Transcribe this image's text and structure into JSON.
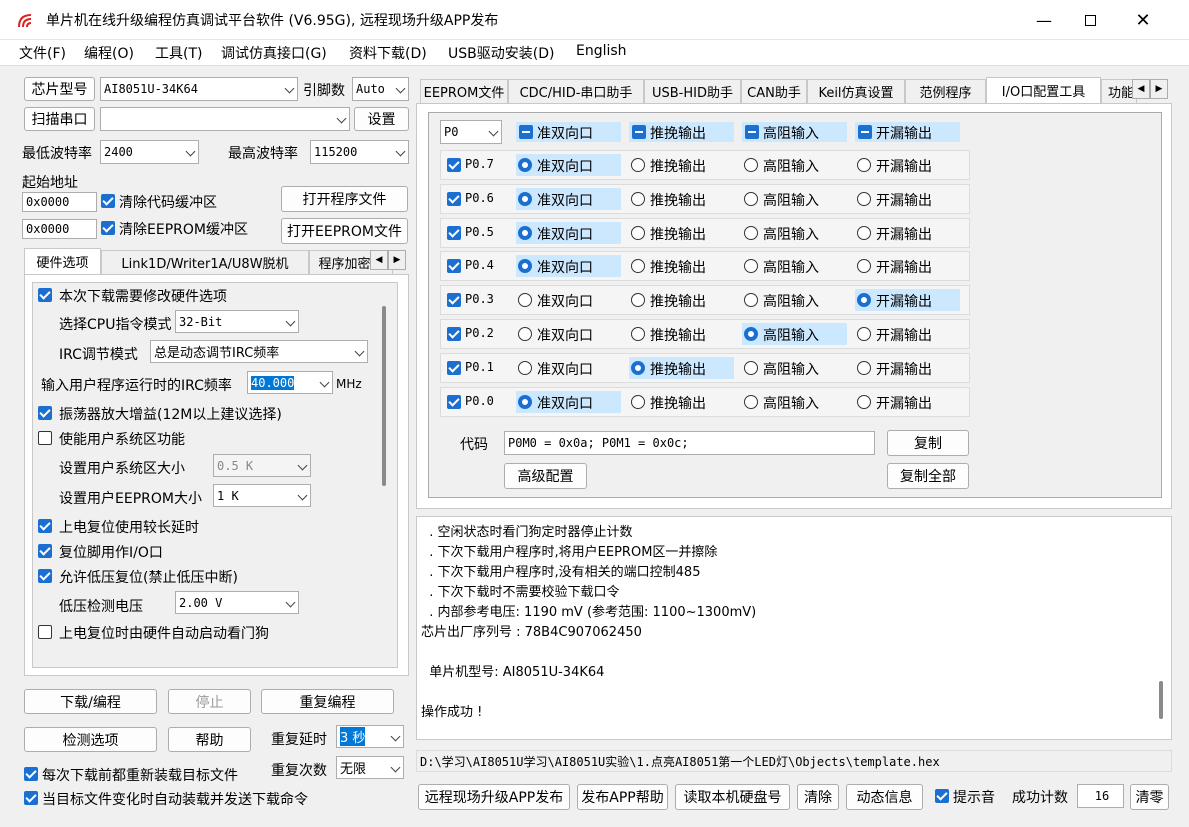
{
  "window": {
    "title": "单片机在线升级编程仿真调试平台软件 (V6.95G), 远程现场升级APP发布"
  },
  "menu": [
    "文件(F)",
    "编程(O)",
    "工具(T)",
    "调试仿真接口(G)",
    "资料下载(D)",
    "USB驱动安装(D)",
    "English"
  ],
  "left": {
    "chip_btn": "芯片型号",
    "chip_value": "AI8051U-34K64",
    "pins_label": "引脚数",
    "pins_value": "Auto",
    "scan_btn": "扫描串口",
    "port_value": "",
    "settings_btn": "设置",
    "min_baud_label": "最低波特率",
    "min_baud": "2400",
    "max_baud_label": "最高波特率",
    "max_baud": "115200",
    "start_addr_label": "起始地址",
    "addr1": "0x0000",
    "clear_code": "清除代码缓冲区",
    "open_prog": "打开程序文件",
    "addr2": "0x0000",
    "clear_eeprom": "清除EEPROM缓冲区",
    "open_eeprom": "打开EEPROM文件",
    "tabs": [
      "硬件选项",
      "Link1D/Writer1A/U8W脱机",
      "程序加密后"
    ],
    "opts": {
      "modify_hw": "本次下载需要修改硬件选项",
      "cpu_mode_label": "选择CPU指令模式",
      "cpu_mode": "32-Bit",
      "irc_mode_label": "IRC调节模式",
      "irc_mode": "总是动态调节IRC频率",
      "irc_freq_label": "输入用户程序运行时的IRC频率",
      "irc_freq": "40.000",
      "irc_unit": "MHz",
      "osc_gain": "振荡器放大增益(12M以上建议选择)",
      "sys_area": "使能用户系统区功能",
      "sys_size_label": "设置用户系统区大小",
      "sys_size": "0.5 K",
      "eeprom_size_label": "设置用户EEPROM大小",
      "eeprom_size": "1   K",
      "power_delay": "上电复位使用较长延时",
      "reset_io": "复位脚用作I/O口",
      "lvr": "允许低压复位(禁止低压中断)",
      "lvd_label": "低压检测电压",
      "lvd": "2.00 V",
      "wdt": "上电复位时由硬件自动启动看门狗"
    },
    "download_btn": "下载/编程",
    "stop_btn": "停止",
    "repeat_btn": "重复编程",
    "check_btn": "检测选项",
    "help_btn": "帮助",
    "repeat_delay_label": "重复延时",
    "repeat_delay": "3 秒",
    "repeat_count_label": "重复次数",
    "repeat_count": "无限",
    "reload_each": "每次下载前都重新装载目标文件",
    "auto_reload": "当目标文件变化时自动装载并发送下载命令"
  },
  "right": {
    "tabs": [
      "EEPROM文件",
      "CDC/HID-串口助手",
      "USB-HID助手",
      "CAN助手",
      "Keil仿真设置",
      "范例程序",
      "I/O口配置工具",
      "功能"
    ],
    "port_select": "P0",
    "modes": [
      "准双向口",
      "推挽输出",
      "高阻输入",
      "开漏输出"
    ],
    "pins": [
      {
        "name": "P0.7",
        "mode": 0
      },
      {
        "name": "P0.6",
        "mode": 0
      },
      {
        "name": "P0.5",
        "mode": 0
      },
      {
        "name": "P0.4",
        "mode": 0
      },
      {
        "name": "P0.3",
        "mode": 3
      },
      {
        "name": "P0.2",
        "mode": 2
      },
      {
        "name": "P0.1",
        "mode": 1
      },
      {
        "name": "P0.0",
        "mode": 0
      }
    ],
    "code_label": "代码",
    "code_value": "P0M0 = 0x0a; P0M1 = 0x0c;",
    "copy_btn": "复制",
    "advanced_btn": "高级配置",
    "copy_all_btn": "复制全部",
    "log": [
      "  . 空闲状态时看门狗定时器停止计数",
      "  . 下次下载用户程序时,将用户EEPROM区一并擦除",
      "  . 下次下载用户程序时,没有相关的端口控制485",
      "  . 下次下载时不需要校验下载口令",
      "  . 内部参考电压: 1190 mV (参考范围: 1100~1300mV)",
      "芯片出厂序列号 : 78B4C907062450",
      "",
      "  单片机型号: AI8051U-34K64",
      "",
      "操作成功 !"
    ],
    "file_path": "D:\\学习\\AI8051U学习\\AI8051U实验\\1.点亮AI8051第一个LED灯\\Objects\\template.hex",
    "remote_btn": "远程现场升级APP发布",
    "publish_help_btn": "发布APP帮助",
    "read_disk_btn": "读取本机硬盘号",
    "clear_btn": "清除",
    "dyn_info_btn": "动态信息",
    "beep_label": "提示音",
    "success_label": "成功计数",
    "success_count": "16",
    "reset_count_btn": "清零"
  }
}
